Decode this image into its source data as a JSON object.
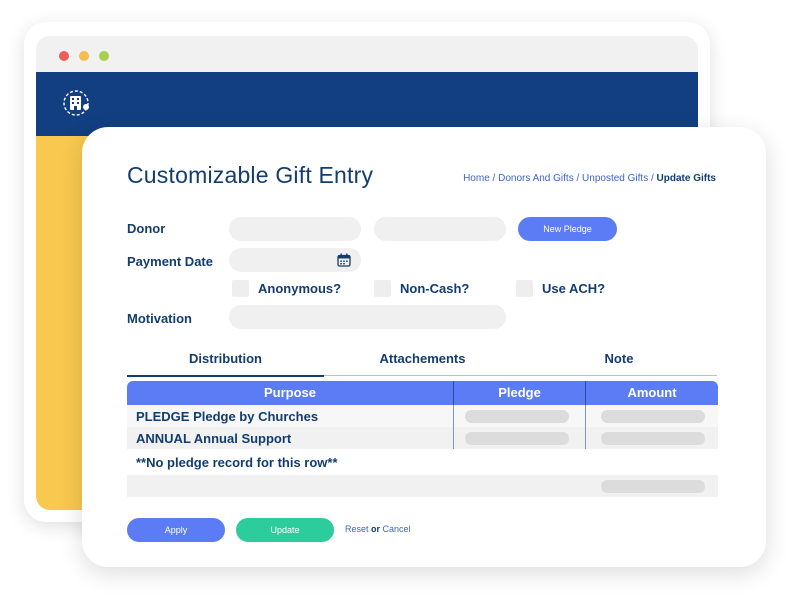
{
  "window": {
    "controls": [
      "close",
      "minimize",
      "maximize"
    ],
    "logo_icon": "building-icon"
  },
  "page": {
    "title": "Customizable Gift Entry",
    "breadcrumb": {
      "home": "Home",
      "donors_and_gifts": "Donors And Gifts",
      "unposted_gifts": "Unposted Gifts",
      "current": "Update Gifts",
      "separator": "/"
    }
  },
  "form": {
    "donor_label": "Donor",
    "new_pledge_label": "New Pledge",
    "payment_date_label": "Payment Date",
    "calendar_icon": "calendar-icon",
    "anonymous_label": "Anonymous?",
    "non_cash_label": "Non-Cash?",
    "use_ach_label": "Use ACH?",
    "motivation_label": "Motivation"
  },
  "tabs": [
    {
      "label": "Distribution",
      "active": true
    },
    {
      "label": "Attachements",
      "active": false
    },
    {
      "label": "Note",
      "active": false
    }
  ],
  "table": {
    "headers": {
      "purpose": "Purpose",
      "pledge": "Pledge",
      "amount": "Amount"
    },
    "rows": [
      {
        "purpose": "PLEDGE Pledge by Churches"
      },
      {
        "purpose": "ANNUAL Annual Support"
      },
      {
        "purpose": "**No pledge record for this row**"
      }
    ]
  },
  "footer": {
    "apply_label": "Apply",
    "update_label": "Update",
    "reset_label": "Reset",
    "or_label": "or",
    "cancel_label": "Cancel"
  },
  "colors": {
    "header_navy": "#123f82",
    "accent_blue": "#5b7cf4",
    "accent_green": "#2dcc9c",
    "background_yellow": "#f8c84f",
    "text_navy": "#133c70"
  }
}
